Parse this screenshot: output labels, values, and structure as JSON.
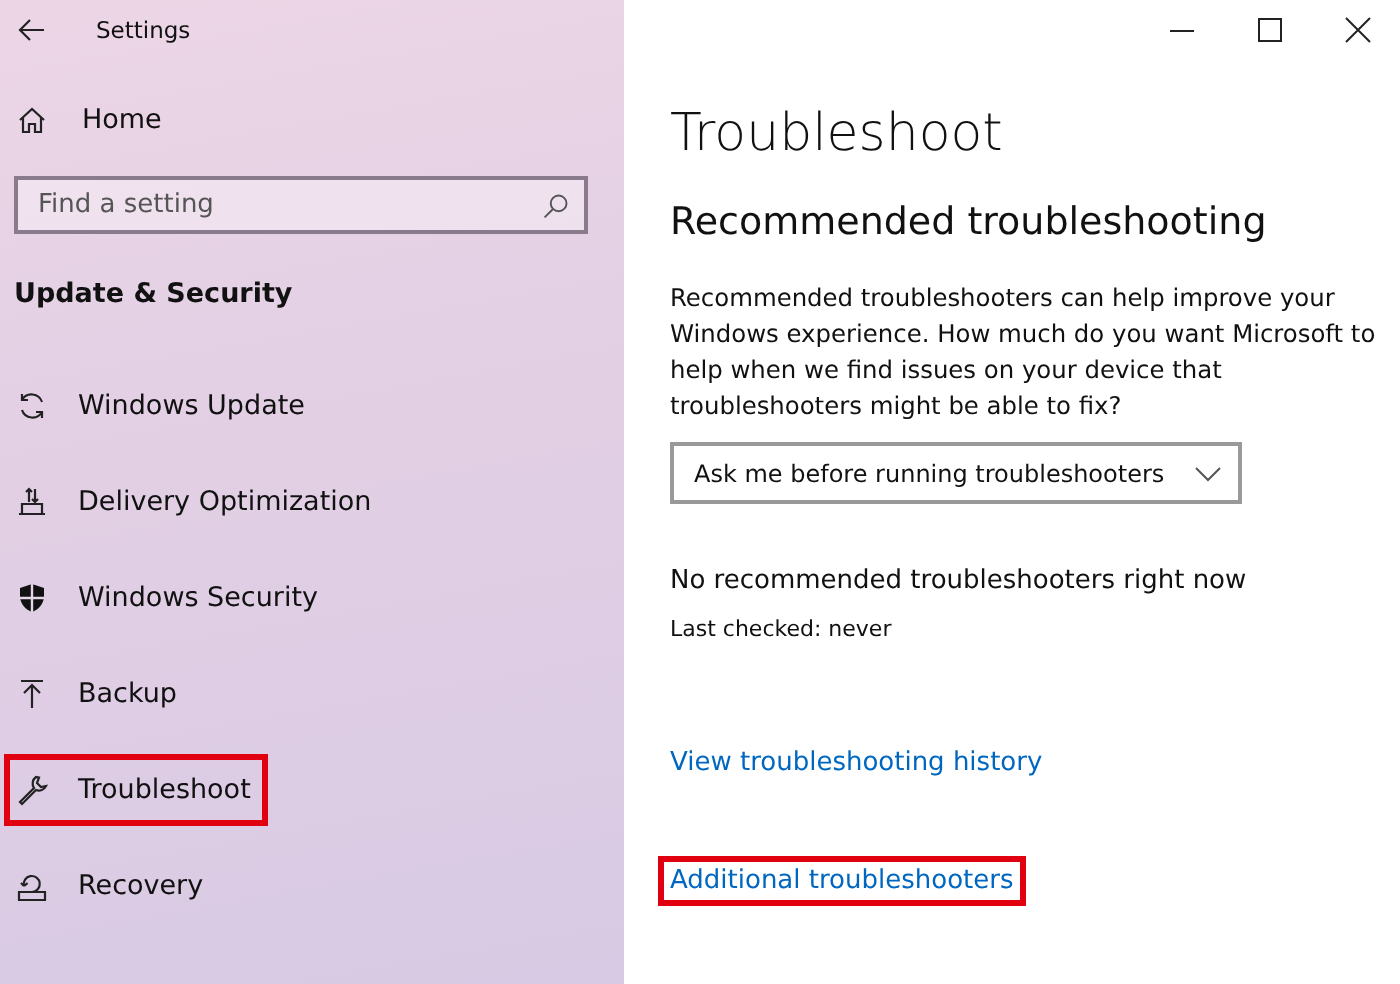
{
  "window": {
    "title": "Settings"
  },
  "sidebar": {
    "home": {
      "label": "Home",
      "kind": "home"
    },
    "search": {
      "placeholder": "Find a setting"
    },
    "section_title": "Update & Security",
    "items": [
      {
        "label": "Windows Update",
        "kind": "update",
        "highlighted": false
      },
      {
        "label": "Delivery Optimization",
        "kind": "delivery",
        "highlighted": false
      },
      {
        "label": "Windows Security",
        "kind": "shield",
        "highlighted": false
      },
      {
        "label": "Backup",
        "kind": "backup",
        "highlighted": false
      },
      {
        "label": "Troubleshoot",
        "kind": "wrench",
        "highlighted": true
      },
      {
        "label": "Recovery",
        "kind": "recovery",
        "highlighted": false
      }
    ]
  },
  "content": {
    "title": "Troubleshoot",
    "heading": "Recommended troubleshooting",
    "description": "Recommended troubleshooters can help improve your Windows experience. How much do you want Microsoft to help when we find issues on your device that troubleshooters might be able to fix?",
    "dropdown": {
      "value": "Ask me before running troubleshooters"
    },
    "status": "No recommended troubleshooters right now",
    "last_checked": "Last checked: never",
    "links": [
      {
        "label": "View troubleshooting history",
        "highlighted": false
      },
      {
        "label": "Additional troubleshooters",
        "highlighted": true
      }
    ]
  }
}
